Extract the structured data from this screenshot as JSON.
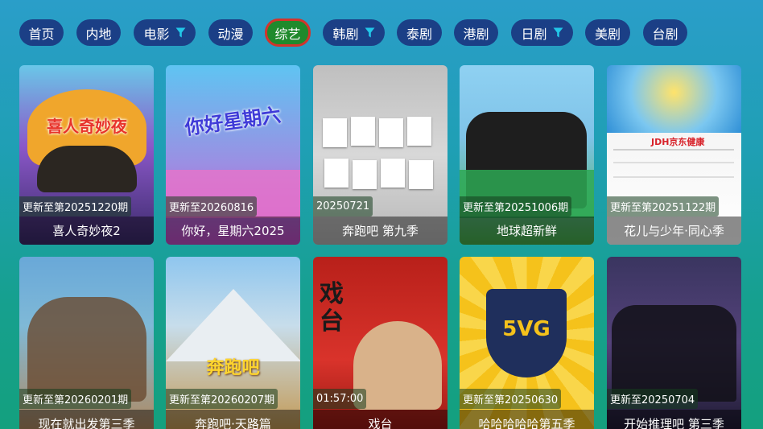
{
  "nav": {
    "tabs": [
      {
        "label": "首页",
        "filter": false,
        "active": false
      },
      {
        "label": "内地",
        "filter": false,
        "active": false
      },
      {
        "label": "电影",
        "filter": true,
        "active": false
      },
      {
        "label": "动漫",
        "filter": false,
        "active": false
      },
      {
        "label": "综艺",
        "filter": false,
        "active": true
      },
      {
        "label": "韩剧",
        "filter": true,
        "active": false
      },
      {
        "label": "泰剧",
        "filter": false,
        "active": false
      },
      {
        "label": "港剧",
        "filter": false,
        "active": false
      },
      {
        "label": "日剧",
        "filter": true,
        "active": false
      },
      {
        "label": "美剧",
        "filter": false,
        "active": false
      },
      {
        "label": "台剧",
        "filter": false,
        "active": false
      }
    ]
  },
  "colors": {
    "tab_bg": "#1b3f86",
    "tab_active_bg": "#1f8a2c",
    "tab_active_border": "#d2342c",
    "filter_icon": "#22c7e8"
  },
  "cards": [
    {
      "status": "更新至第20251220期",
      "title": "喜人奇妙夜2",
      "poster_text": "喜人奇妙夜"
    },
    {
      "status": "更新至20260816",
      "title": "你好，星期六2025",
      "poster_text": "你好星期六"
    },
    {
      "status": "20250721",
      "title": "奔跑吧 第九季"
    },
    {
      "status": "更新至第20251006期",
      "title": "地球超新鲜"
    },
    {
      "status": "更新至第20251122期",
      "title": "花儿与少年·同心季",
      "poster_text": "JDH京东健康"
    },
    {
      "status": "更新至第20260201期",
      "title": "现在就出发第三季"
    },
    {
      "status": "更新至第20260207期",
      "title": "奔跑吧·天路篇",
      "poster_text": "奔跑吧"
    },
    {
      "status": "01:57:00",
      "title": "戏台",
      "poster_text": "戏台"
    },
    {
      "status": "更新至第20250630",
      "title": "哈哈哈哈哈第五季",
      "poster_text": "5VG"
    },
    {
      "status": "更新至20250704",
      "title": "开始推理吧 第三季"
    }
  ]
}
